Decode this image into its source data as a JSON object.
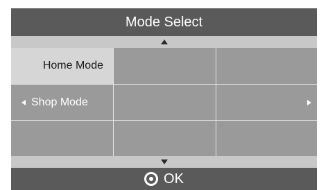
{
  "title": "Mode Select",
  "modes": [
    {
      "label": "Home Mode",
      "selected": true
    },
    {
      "label": "Shop Mode",
      "selected": false
    }
  ],
  "footer": {
    "ok_label": "OK"
  },
  "icons": {
    "scroll_up": "triangle-up-icon",
    "scroll_down": "triangle-down-icon",
    "option_left": "triangle-left-icon",
    "option_right": "triangle-right-icon",
    "ok": "circle-button-icon"
  },
  "colors": {
    "title_bg": "#5a5a5a",
    "panel_bg": "#9a9a9a",
    "selected_bg": "#d6d6d6",
    "arrow_bar_bg": "#c8c8c8"
  }
}
